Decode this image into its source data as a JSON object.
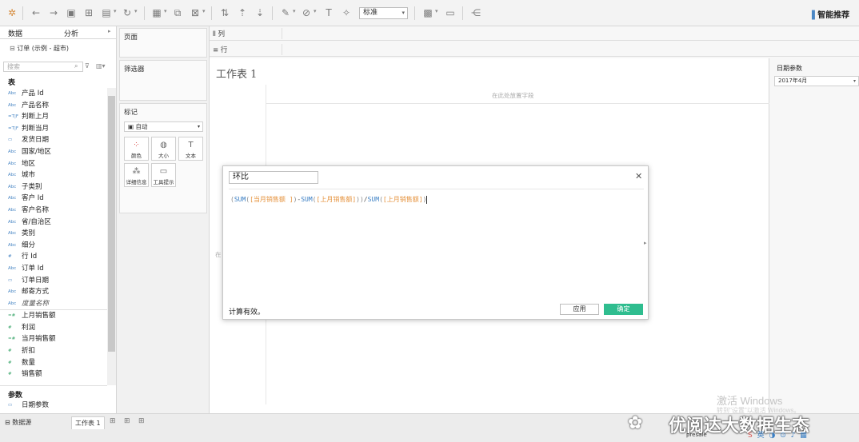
{
  "toolbar": {
    "format_select": "标准",
    "smart_recommend": "智能推荐",
    "icons": [
      "tableau-logo-icon",
      "undo-icon",
      "redo-icon",
      "save-icon",
      "new-datasource-icon",
      "paste-icon",
      "refresh-icon",
      "new-sheet-icon",
      "duplicate-icon",
      "clear-icon",
      "swap-icon",
      "sort-asc-icon",
      "sort-desc-icon",
      "highlight-icon",
      "group-icon",
      "label-icon",
      "pin-icon",
      "fit-icon",
      "presentation-icon",
      "share-icon"
    ],
    "colors": {
      "accent": "#2fbd8f",
      "dimension": "#4a87c5",
      "measure": "#3aa66b"
    }
  },
  "left_panel": {
    "tabs": [
      "数据",
      "分析"
    ],
    "datasource": "订单 (示例 - 超市)",
    "search_placeholder": "搜索",
    "section_table": "表",
    "dimensions": [
      {
        "type": "Abc",
        "name": "产品 Id"
      },
      {
        "type": "Abc",
        "name": "产品名称"
      },
      {
        "type": "=T|F",
        "name": "判断上月"
      },
      {
        "type": "=T|F",
        "name": "判断当月"
      },
      {
        "type": "date",
        "name": "发货日期"
      },
      {
        "type": "Abc",
        "name": "国家/地区"
      },
      {
        "type": "Abc",
        "name": "地区"
      },
      {
        "type": "Abc",
        "name": "城市"
      },
      {
        "type": "Abc",
        "name": "子类别"
      },
      {
        "type": "Abc",
        "name": "客户 Id"
      },
      {
        "type": "Abc",
        "name": "客户名称"
      },
      {
        "type": "Abc",
        "name": "省/自治区"
      },
      {
        "type": "Abc",
        "name": "类别"
      },
      {
        "type": "Abc",
        "name": "细分"
      },
      {
        "type": "#",
        "name": "行 Id"
      },
      {
        "type": "Abc",
        "name": "订单 Id"
      },
      {
        "type": "date",
        "name": "订单日期"
      },
      {
        "type": "Abc",
        "name": "邮寄方式"
      },
      {
        "type": "Abc",
        "name": "度量名称"
      }
    ],
    "measures": [
      {
        "type": "=#",
        "name": "上月销售额"
      },
      {
        "type": "#",
        "name": "利润"
      },
      {
        "type": "=#",
        "name": "当月销售额"
      },
      {
        "type": "#",
        "name": "折扣"
      },
      {
        "type": "#",
        "name": "数量"
      },
      {
        "type": "#",
        "name": "销售额"
      }
    ],
    "section_params": "参数",
    "params": [
      {
        "name": "日期参数"
      }
    ]
  },
  "cards": {
    "pages": "页面",
    "filters": "筛选器",
    "marks": "标记",
    "marks_type": "自动",
    "mark_buttons": [
      "颜色",
      "大小",
      "文本",
      "详细信息",
      "工具提示"
    ]
  },
  "shelves": {
    "columns": "列",
    "rows": "行"
  },
  "canvas": {
    "title": "工作表 1",
    "drop_hint": "在此处放置字段",
    "side_hint": "在"
  },
  "parameter": {
    "title": "日期参数",
    "value": "2017年4月"
  },
  "calc_dialog": {
    "name": "环比",
    "formula_tokens": [
      {
        "c": "p",
        "t": "("
      },
      {
        "c": "fn",
        "t": "SUM"
      },
      {
        "c": "p",
        "t": "("
      },
      {
        "c": "fd",
        "t": "[当月销售额 ]"
      },
      {
        "c": "p",
        "t": ")"
      },
      {
        "c": "op",
        "t": "-"
      },
      {
        "c": "fn",
        "t": "SUM"
      },
      {
        "c": "p",
        "t": "("
      },
      {
        "c": "fd",
        "t": "[上月销售额]"
      },
      {
        "c": "p",
        "t": "))"
      },
      {
        "c": "op",
        "t": "/"
      },
      {
        "c": "fn",
        "t": "SUM"
      },
      {
        "c": "p",
        "t": "("
      },
      {
        "c": "fd",
        "t": "[上月销售额]"
      },
      {
        "c": "p",
        "t": ")"
      }
    ],
    "status": "计算有效。",
    "apply": "应用",
    "ok": "确定"
  },
  "bottom": {
    "datasource_tab": "数据源",
    "sheet_tab": "工作表 1"
  },
  "overlay": {
    "windows_activate": "激活 Windows",
    "windows_activate_sub": "转到\"设置\"以激活 Windows。",
    "brand": "优阅达大数据生态",
    "taskbar": "presale"
  }
}
